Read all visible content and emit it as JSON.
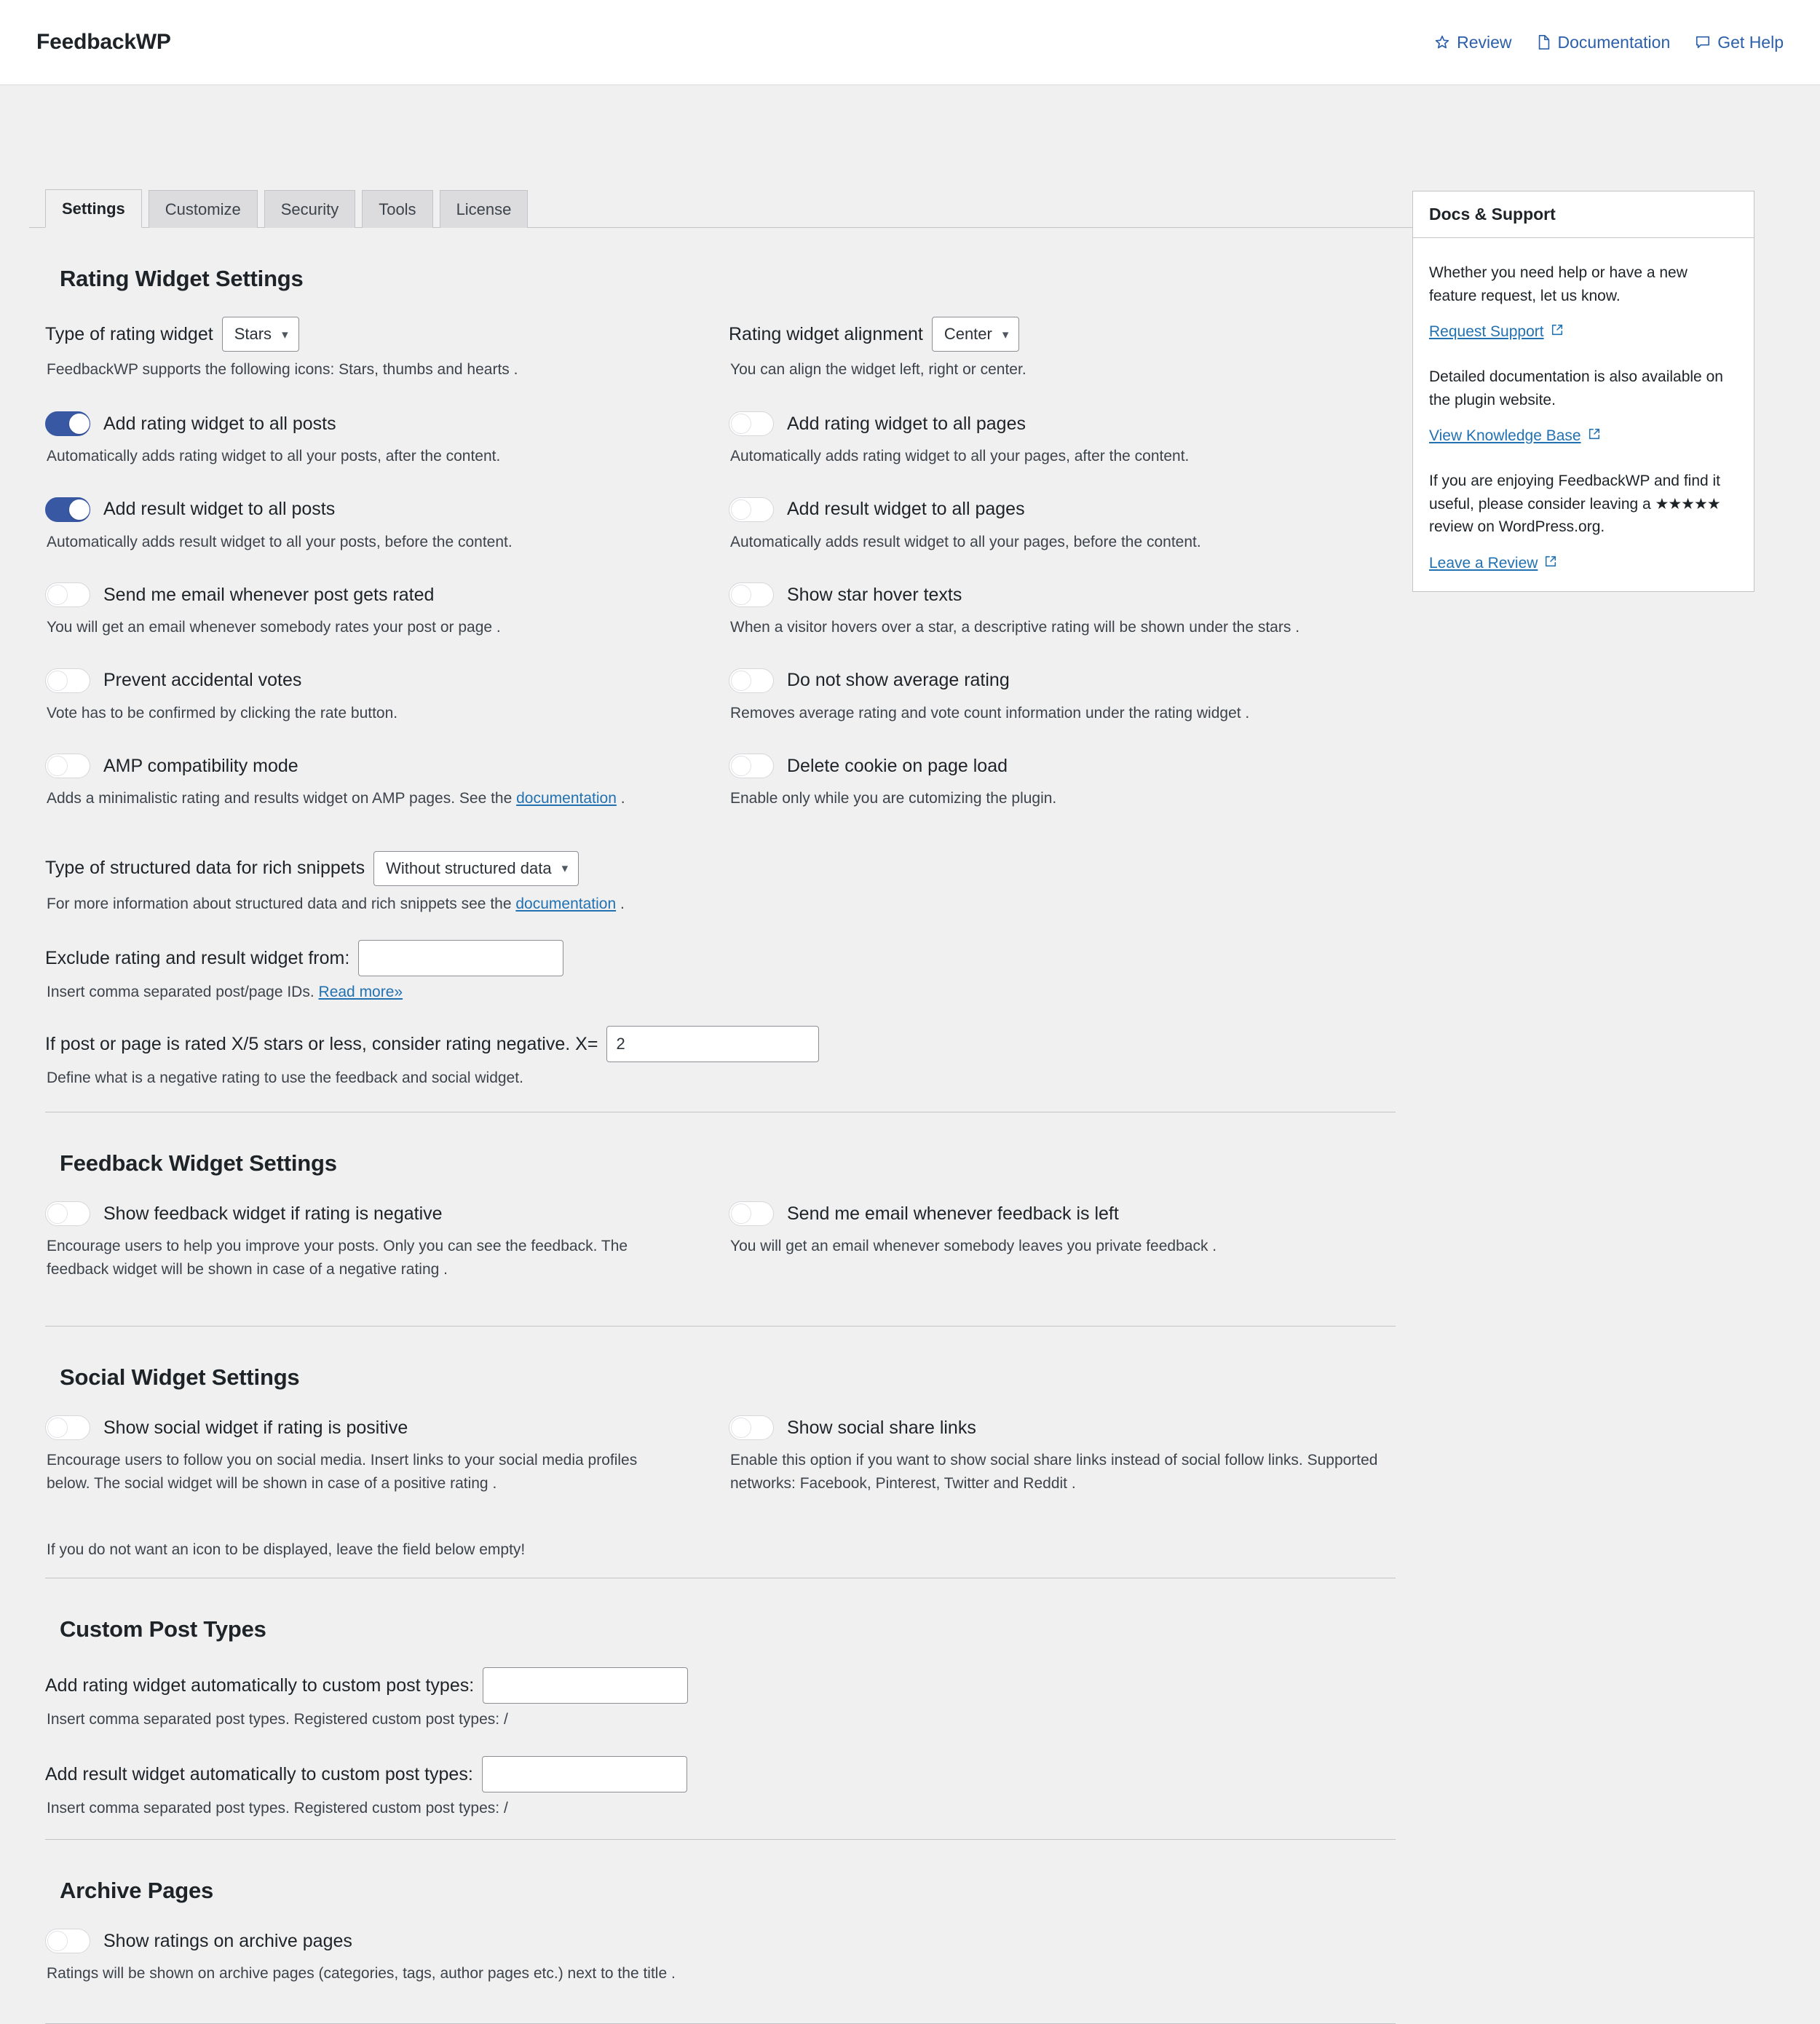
{
  "header": {
    "brand": "FeedbackWP",
    "links": [
      {
        "label": "Review",
        "icon": "star-icon"
      },
      {
        "label": "Documentation",
        "icon": "document-icon"
      },
      {
        "label": "Get Help",
        "icon": "chat-icon"
      }
    ]
  },
  "tabs": [
    {
      "label": "Settings",
      "active": true
    },
    {
      "label": "Customize",
      "active": false
    },
    {
      "label": "Security",
      "active": false
    },
    {
      "label": "Tools",
      "active": false
    },
    {
      "label": "License",
      "active": false
    }
  ],
  "rating_section": {
    "title": "Rating Widget Settings",
    "type_label": "Type of rating widget",
    "type_value": "Stars",
    "type_help": "FeedbackWP supports the following icons: Stars, thumbs and hearts .",
    "align_label": "Rating widget alignment",
    "align_value": "Center",
    "align_help": "You can align the widget left, right or center.",
    "toggles_left": [
      {
        "label": "Add rating widget to all posts",
        "on": true,
        "desc": "Automatically adds rating widget to all your posts, after the content."
      },
      {
        "label": "Add result widget to all posts",
        "on": true,
        "desc": "Automatically adds result widget to all your posts, before the content."
      },
      {
        "label": "Send me email whenever post gets rated",
        "on": false,
        "desc": "You will get an email whenever somebody rates your post or page ."
      },
      {
        "label": "Prevent accidental votes",
        "on": false,
        "desc": "Vote has to be confirmed by clicking the rate button."
      },
      {
        "label": "AMP compatibility mode",
        "on": false,
        "desc_pre": "Adds a minimalistic rating and results widget on AMP pages. See the ",
        "desc_link": "documentation",
        "desc_post": " ."
      }
    ],
    "toggles_right": [
      {
        "label": "Add rating widget to all pages",
        "on": false,
        "desc": "Automatically adds rating widget to all your pages, after the content."
      },
      {
        "label": "Add result widget to all pages",
        "on": false,
        "desc": "Automatically adds result widget to all your pages, before the content."
      },
      {
        "label": "Show star hover texts",
        "on": false,
        "desc": "When a visitor hovers over a star, a descriptive rating will be shown under the stars ."
      },
      {
        "label": "Do not show average rating",
        "on": false,
        "desc": "Removes average rating and vote count information under the rating widget ."
      },
      {
        "label": "Delete cookie on page load",
        "on": false,
        "desc": "Enable only while you are cutomizing the plugin."
      }
    ],
    "structured_label": "Type of structured data for rich snippets",
    "structured_value": "Without structured data",
    "structured_help_pre": "For more information about structured data and rich snippets see the ",
    "structured_help_link": "documentation",
    "structured_help_post": " .",
    "exclude_label": "Exclude rating and result widget from:",
    "exclude_value": "",
    "exclude_help_pre": "Insert comma separated post/page IDs. ",
    "exclude_help_link": "Read more»",
    "negative_label": "If post or page is rated X/5 stars or less, consider rating negative. X=",
    "negative_value": "2",
    "negative_help": "Define what is a negative rating to use the feedback and social widget."
  },
  "feedback_section": {
    "title": "Feedback Widget Settings",
    "left": {
      "label": "Show feedback widget if rating is negative",
      "on": false,
      "desc": "Encourage users to help you improve your posts. Only you can see the feedback. The feedback widget will be shown in case of a negative rating ."
    },
    "right": {
      "label": "Send me email whenever feedback is left",
      "on": false,
      "desc": "You will get an email whenever somebody leaves you private feedback ."
    }
  },
  "social_section": {
    "title": "Social Widget Settings",
    "left": {
      "label": "Show social widget if rating is positive",
      "on": false,
      "desc": "Encourage users to follow you on social media. Insert links to your social media profiles below. The social widget will be shown in case of a positive rating ."
    },
    "right": {
      "label": "Show social share links",
      "on": false,
      "desc": "Enable this option if you want to show social share links instead of social follow links. Supported networks: Facebook, Pinterest, Twitter and Reddit ."
    },
    "note": "If you do not want an icon to be displayed, leave the field below empty!"
  },
  "cpt_section": {
    "title": "Custom Post Types",
    "rating_label": "Add rating widget automatically to custom post types:",
    "rating_value": "",
    "rating_help": "Insert comma separated post types. Registered custom post types: /",
    "result_label": "Add result widget automatically to custom post types:",
    "result_value": "",
    "result_help": "Insert comma separated post types. Registered custom post types: /"
  },
  "archive_section": {
    "title": "Archive Pages",
    "toggle_label": "Show ratings on archive pages",
    "toggle_on": false,
    "desc": "Ratings will be shown on archive pages (categories, tags, author pages etc.) next to the title ."
  },
  "sidebar": {
    "title": "Docs & Support",
    "p1": "Whether you need help or have a new feature request, let us know.",
    "link1": "Request Support",
    "p2": "Detailed documentation is also available on the plugin website.",
    "link2": "View Knowledge Base",
    "p3_pre": "If you are enjoying FeedbackWP and find it useful, please consider leaving a ",
    "p3_stars": "★★★★★",
    "p3_post": " review on WordPress.org.",
    "link3": "Leave a Review"
  },
  "colors": {
    "accent": "#2271b1",
    "toggle_on": "#3858a4",
    "page_bg": "#f0f0f1",
    "border": "#c3c4c7"
  }
}
